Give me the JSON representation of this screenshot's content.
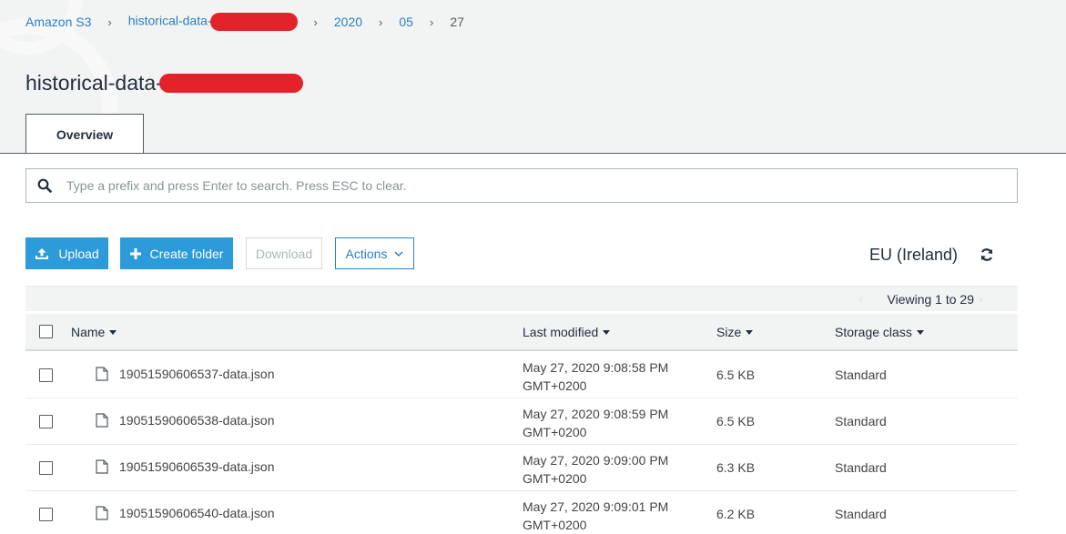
{
  "breadcrumb": {
    "root": "Amazon S3",
    "bucket": "historical-data-",
    "year": "2020",
    "month": "05",
    "day": "27"
  },
  "page": {
    "title": "historical-data-"
  },
  "tabs": [
    {
      "label": "Overview",
      "active": true
    }
  ],
  "search": {
    "placeholder": "Type a prefix and press Enter to search. Press ESC to clear.",
    "value": ""
  },
  "toolbar": {
    "upload_label": "Upload",
    "create_folder_label": "Create folder",
    "download_label": "Download",
    "actions_label": "Actions"
  },
  "region": "EU (Ireland)",
  "viewing": "Viewing 1 to 29",
  "table": {
    "columns": [
      "Name",
      "Last modified",
      "Size",
      "Storage class"
    ],
    "rows": [
      {
        "name": "19051590606537-data.json",
        "modified_line1": "May 27, 2020 9:08:58 PM",
        "modified_line2": "GMT+0200",
        "size": "6.5 KB",
        "storage_class": "Standard"
      },
      {
        "name": "19051590606538-data.json",
        "modified_line1": "May 27, 2020 9:08:59 PM",
        "modified_line2": "GMT+0200",
        "size": "6.5 KB",
        "storage_class": "Standard"
      },
      {
        "name": "19051590606539-data.json",
        "modified_line1": "May 27, 2020 9:09:00 PM",
        "modified_line2": "GMT+0200",
        "size": "6.3 KB",
        "storage_class": "Standard"
      },
      {
        "name": "19051590606540-data.json",
        "modified_line1": "May 27, 2020 9:09:01 PM",
        "modified_line2": "GMT+0200",
        "size": "6.2 KB",
        "storage_class": "Standard"
      }
    ]
  },
  "colors": {
    "link": "#2b80c5",
    "primary_button": "#2d9ad9",
    "redaction": "#e32229",
    "header_bg": "#f2f3f3"
  }
}
